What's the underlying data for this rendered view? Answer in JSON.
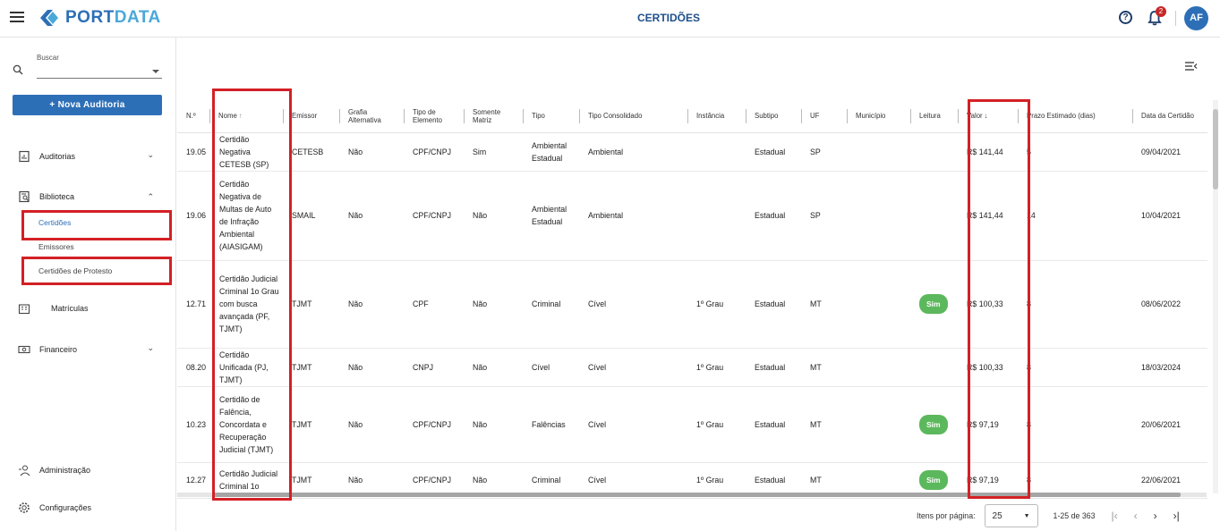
{
  "app": {
    "logo_text_1": "PORT",
    "logo_text_2": "DATA",
    "page_title": "CERTIDÕES",
    "help": "?",
    "notifications_count": "2",
    "user_initials": "AF"
  },
  "sidebar": {
    "search_label": "Buscar",
    "search_value": "",
    "new_audit": "+ Nova Auditoria",
    "items": {
      "auditorias": "Auditorias",
      "biblioteca": "Biblioteca",
      "certidoes": "Certidões",
      "emissores": "Emissores",
      "certidoes_protesto": "Certidões de Protesto",
      "matriculas": "Matrículas",
      "financeiro": "Financeiro",
      "administracao": "Administração",
      "configuracoes": "Configurações"
    }
  },
  "table": {
    "headers": {
      "num": "N.º",
      "nome": "Nome",
      "emissor": "Emissor",
      "grafia": "Grafia Alternativa",
      "tipo_elemento": "Tipo de Elemento",
      "somente_matriz": "Somente Matriz",
      "tipo": "Tipo",
      "tipo_consolidado": "Tipo Consolidado",
      "instancia": "Instância",
      "subtipo": "Subtipo",
      "uf": "UF",
      "municipio": "Município",
      "leitura": "Leitura",
      "valor": "Valor",
      "prazo": "Prazo Estimado (dias)",
      "data": "Data da Certidão"
    },
    "rows": [
      {
        "num": "19.05",
        "nome": "Certidão Negativa CETESB (SP)",
        "emissor": "CETESB",
        "grafia": "Não",
        "tipo_elemento": "CPF/CNPJ",
        "somente_matriz": "Sim",
        "tipo": "Ambiental Estadual",
        "tipo_consolidado": "Ambiental",
        "instancia": "",
        "subtipo": "Estadual",
        "uf": "SP",
        "municipio": "",
        "leitura": "",
        "valor": "R$ 141,44",
        "prazo": "5",
        "data": "09/04/2021"
      },
      {
        "num": "19.06",
        "nome": "Certidão Negativa de Multas de Auto de Infração Ambiental (AIASIGAM)",
        "emissor": "SMAIL",
        "grafia": "Não",
        "tipo_elemento": "CPF/CNPJ",
        "somente_matriz": "Não",
        "tipo": "Ambiental Estadual",
        "tipo_consolidado": "Ambiental",
        "instancia": "",
        "subtipo": "Estadual",
        "uf": "SP",
        "municipio": "",
        "leitura": "",
        "valor": "R$ 141,44",
        "prazo": "14",
        "data": "10/04/2021"
      },
      {
        "num": "12.71",
        "nome": "Certidão Judicial Criminal 1o Grau com busca avançada (PF, TJMT)",
        "emissor": "TJMT",
        "grafia": "Não",
        "tipo_elemento": "CPF",
        "somente_matriz": "Não",
        "tipo": "Criminal",
        "tipo_consolidado": "Cível",
        "instancia": "1º Grau",
        "subtipo": "Estadual",
        "uf": "MT",
        "municipio": "",
        "leitura": "Sim",
        "valor": "R$ 100,33",
        "prazo": "8",
        "data": "08/06/2022"
      },
      {
        "num": "08.20",
        "nome": "Certidão Unificada (PJ, TJMT)",
        "emissor": "TJMT",
        "grafia": "Não",
        "tipo_elemento": "CNPJ",
        "somente_matriz": "Não",
        "tipo": "Cível",
        "tipo_consolidado": "Cível",
        "instancia": "1º Grau",
        "subtipo": "Estadual",
        "uf": "MT",
        "municipio": "",
        "leitura": "",
        "valor": "R$ 100,33",
        "prazo": "8",
        "data": "18/03/2024"
      },
      {
        "num": "10.23",
        "nome": "Certidão de Falência, Concordata e Recuperação Judicial (TJMT)",
        "emissor": "TJMT",
        "grafia": "Não",
        "tipo_elemento": "CPF/CNPJ",
        "somente_matriz": "Não",
        "tipo": "Falências",
        "tipo_consolidado": "Cível",
        "instancia": "1º Grau",
        "subtipo": "Estadual",
        "uf": "MT",
        "municipio": "",
        "leitura": "Sim",
        "valor": "R$ 97,19",
        "prazo": "8",
        "data": "20/06/2021"
      },
      {
        "num": "12.27",
        "nome": "Certidão Judicial Criminal 1o",
        "emissor": "TJMT",
        "grafia": "Não",
        "tipo_elemento": "CPF/CNPJ",
        "somente_matriz": "Não",
        "tipo": "Criminal",
        "tipo_consolidado": "Cível",
        "instancia": "1º Grau",
        "subtipo": "Estadual",
        "uf": "MT",
        "municipio": "",
        "leitura": "Sim",
        "valor": "R$ 97,19",
        "prazo": "8",
        "data": "22/06/2021"
      }
    ]
  },
  "pagination": {
    "label": "Itens por página:",
    "page_size": "25",
    "range": "1-25 de 363"
  },
  "colors": {
    "brand": "#2d6fb7",
    "highlight": "#d32025",
    "pill": "#5cb85c"
  }
}
